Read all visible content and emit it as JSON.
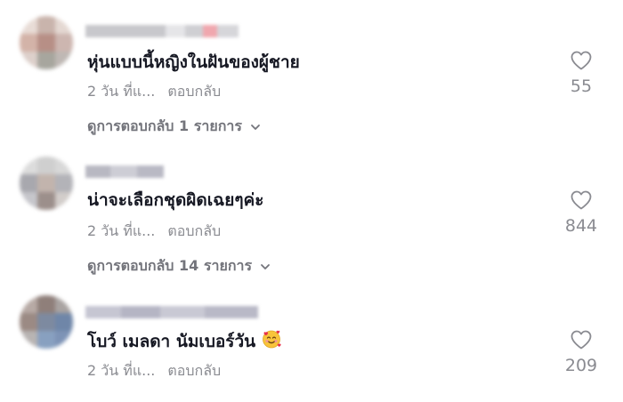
{
  "comments": [
    {
      "text": "หุ่นแบบนี้หญิงในฝันของผู้ชาย",
      "time": "2 วัน ที่แ...",
      "reply_label": "ตอบกลับ",
      "view_replies": "ดูการตอบกลับ 1 รายการ",
      "likes": "55",
      "icon": "heart-outline-icon"
    },
    {
      "text": "น่าจะเลือกชุดผิดเฉยๆค่ะ",
      "time": "2 วัน ที่แ...",
      "reply_label": "ตอบกลับ",
      "view_replies": "ดูการตอบกลับ 14 รายการ",
      "likes": "844",
      "icon": "heart-outline-icon"
    },
    {
      "text": "โบว์ เมลดา นัมเบอร์วัน",
      "emoji": "smiling-face-with-hearts",
      "time": "2 วัน ที่แ...",
      "reply_label": "ตอบกลับ",
      "likes": "209",
      "icon": "heart-outline-icon"
    }
  ],
  "colors": {
    "text_primary": "#161823",
    "text_secondary": "#8a8b91",
    "view_replies": "#73747b",
    "background": "#ffffff"
  }
}
